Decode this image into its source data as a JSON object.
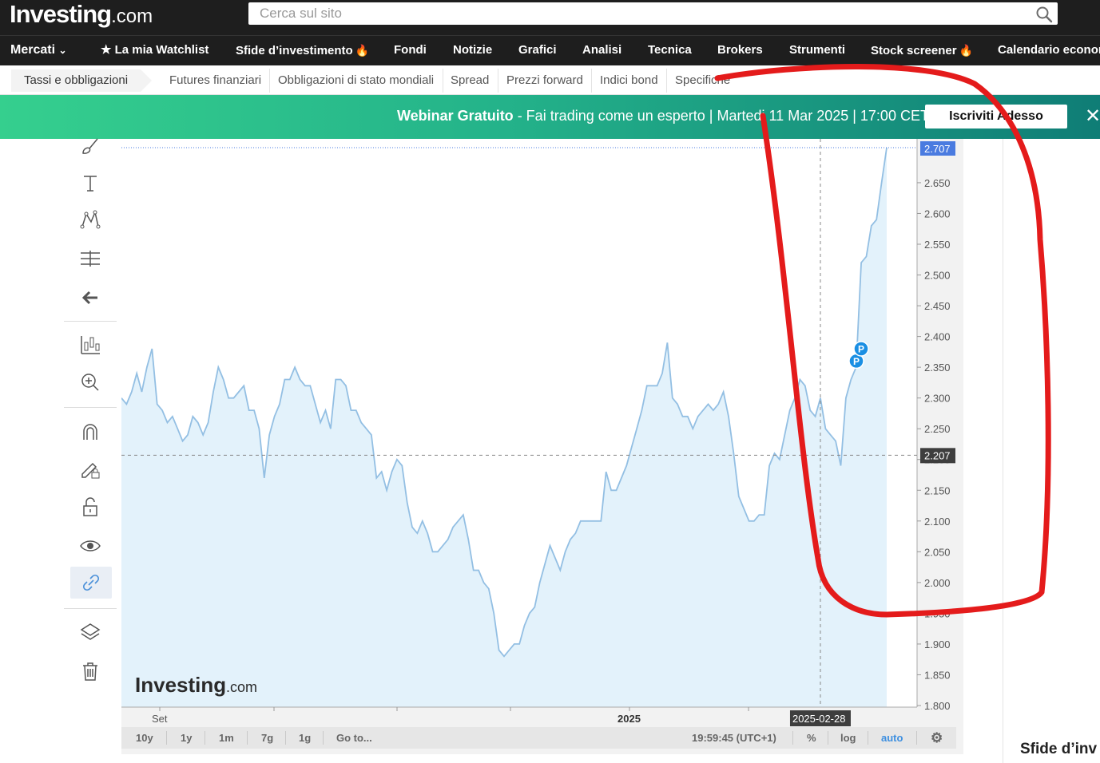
{
  "header": {
    "logo_main": "Investing",
    "logo_suffix": ".com",
    "search_placeholder": "Cerca sul sito"
  },
  "nav": {
    "items": [
      "Mercati",
      "La mia Watchlist",
      "Sfide d’investimento",
      "Fondi",
      "Notizie",
      "Grafici",
      "Analisi",
      "Tecnica",
      "Brokers",
      "Strumenti",
      "Stock screener",
      "Calendario econom"
    ]
  },
  "subnav": {
    "items": [
      "Tassi e obbligazioni",
      "Futures finanziari",
      "Obbligazioni di stato mondiali",
      "Spread",
      "Prezzi forward",
      "Indici bond",
      "Specifiche"
    ]
  },
  "banner": {
    "bold": "Webinar Gratuito",
    "text": " - Fai trading come un esperto | Martedi 11 Mar 2025 | 17:00 CET",
    "button": "Iscriviti Adesso",
    "close": "✕"
  },
  "chart": {
    "watermark_main": "Investing",
    "watermark_suffix": ".com",
    "current_price_label": "2.707",
    "crosshair_price_label": "2.207",
    "crosshair_date_label": "2025-02-28",
    "marker_label": "P"
  },
  "chart_data": {
    "type": "area",
    "x_axis_labels": [
      "Set",
      "2025"
    ],
    "ylim": [
      1.8,
      2.72
    ],
    "yticks": [
      "1.800",
      "1.850",
      "1.900",
      "1.950",
      "2.000",
      "2.050",
      "2.100",
      "2.150",
      "2.200",
      "2.250",
      "2.300",
      "2.350",
      "2.400",
      "2.450",
      "2.500",
      "2.550",
      "2.600",
      "2.650",
      "2.707"
    ],
    "series": [
      {
        "values": [
          2.3,
          2.29,
          2.31,
          2.34,
          2.31,
          2.35,
          2.38,
          2.29,
          2.28,
          2.26,
          2.27,
          2.25,
          2.23,
          2.24,
          2.27,
          2.26,
          2.24,
          2.26,
          2.31,
          2.35,
          2.33,
          2.3,
          2.3,
          2.31,
          2.32,
          2.28,
          2.28,
          2.25,
          2.17,
          2.24,
          2.27,
          2.29,
          2.33,
          2.33,
          2.35,
          2.33,
          2.32,
          2.32,
          2.29,
          2.26,
          2.28,
          2.25,
          2.33,
          2.33,
          2.32,
          2.28,
          2.28,
          2.26,
          2.25,
          2.24,
          2.17,
          2.18,
          2.15,
          2.18,
          2.2,
          2.19,
          2.13,
          2.09,
          2.08,
          2.1,
          2.08,
          2.05,
          2.05,
          2.06,
          2.07,
          2.09,
          2.1,
          2.11,
          2.07,
          2.02,
          2.02,
          2.0,
          1.99,
          1.95,
          1.89,
          1.88,
          1.89,
          1.9,
          1.9,
          1.93,
          1.95,
          1.96,
          2.0,
          2.03,
          2.06,
          2.04,
          2.02,
          2.05,
          2.07,
          2.08,
          2.1,
          2.1,
          2.1,
          2.1,
          2.1,
          2.18,
          2.15,
          2.15,
          2.17,
          2.19,
          2.22,
          2.25,
          2.28,
          2.32,
          2.32,
          2.32,
          2.34,
          2.39,
          2.3,
          2.29,
          2.27,
          2.27,
          2.25,
          2.27,
          2.28,
          2.29,
          2.28,
          2.29,
          2.31,
          2.27,
          2.21,
          2.14,
          2.12,
          2.1,
          2.1,
          2.11,
          2.11,
          2.19,
          2.21,
          2.2,
          2.24,
          2.28,
          2.3,
          2.33,
          2.32,
          2.28,
          2.27,
          2.3,
          2.25,
          2.24,
          2.23,
          2.19,
          2.3,
          2.33,
          2.35,
          2.52,
          2.53,
          2.58,
          2.59,
          2.65,
          2.707
        ]
      }
    ],
    "crosshair": {
      "price": 2.207,
      "date": "2025-02-28"
    },
    "markers": [
      {
        "label": "P",
        "value": 2.36
      },
      {
        "label": "P",
        "value": 2.38
      }
    ]
  },
  "bottombar": {
    "ranges": [
      "10y",
      "1y",
      "1m",
      "7g",
      "1g"
    ],
    "goto": "Go to...",
    "time": "19:59:45 (UTC+1)",
    "percent": "%",
    "log": "log",
    "auto": "auto"
  },
  "right": {
    "partial_heading": "Sfide d’inv"
  },
  "colors": {
    "line": "#93bfe3",
    "fill": "#e3f2fb",
    "annotation": "#e41b1b",
    "price_label": "#4a7be0",
    "crosshair_label": "#3e3e3e",
    "marker": "#1a8fe3"
  }
}
